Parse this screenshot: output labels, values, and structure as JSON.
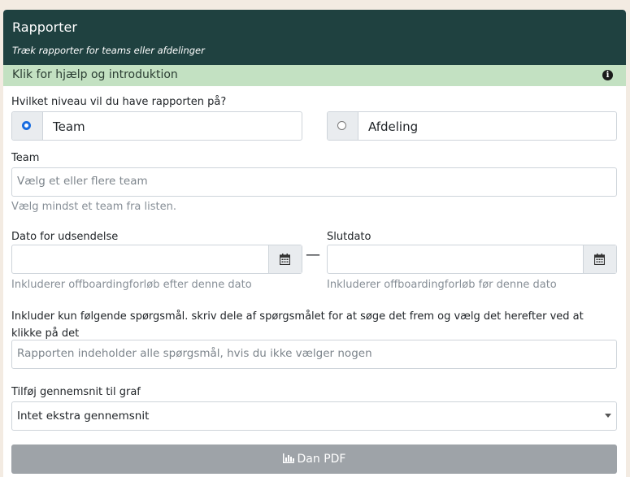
{
  "header": {
    "title": "Rapporter",
    "subtitle": "Træk rapporter for teams eller afdelinger"
  },
  "help": {
    "label": "Klik for hjælp og introduktion",
    "icon": "info-icon"
  },
  "level": {
    "question": "Hvilket niveau vil du have rapporten på?",
    "options": [
      {
        "label": "Team",
        "checked": true
      },
      {
        "label": "Afdeling",
        "checked": false
      }
    ]
  },
  "team": {
    "label": "Team",
    "placeholder": "Vælg et eller flere team",
    "hint": "Vælg mindst et team fra listen."
  },
  "dates": {
    "start_label": "Dato for udsendelse",
    "start_hint": "Inkluderer offboardingforløb efter denne dato",
    "separator": "—",
    "end_label": "Slutdato",
    "end_hint": "Inkluderer offboardingforløb før denne dato",
    "icon": "calendar-icon"
  },
  "questions": {
    "label": "Inkluder kun følgende spørgsmål. skriv dele af spørgsmålet for at søge det frem og vælg det herefter ved at klikke på det",
    "placeholder": "Rapporten indeholder alle spørgsmål, hvis du ikke vælger nogen"
  },
  "average": {
    "label": "Tilføj gennemsnit til graf",
    "selected": "Intet ekstra gennemsnit"
  },
  "submit": {
    "label": "Dan PDF",
    "icon": "bar-chart-icon"
  },
  "colors": {
    "header_bg": "#1f4140",
    "help_bg": "#c3e1c2",
    "radio_accent": "#1a6de0",
    "button_bg": "#9ea3a8",
    "page_bg": "#f3ebe2"
  }
}
